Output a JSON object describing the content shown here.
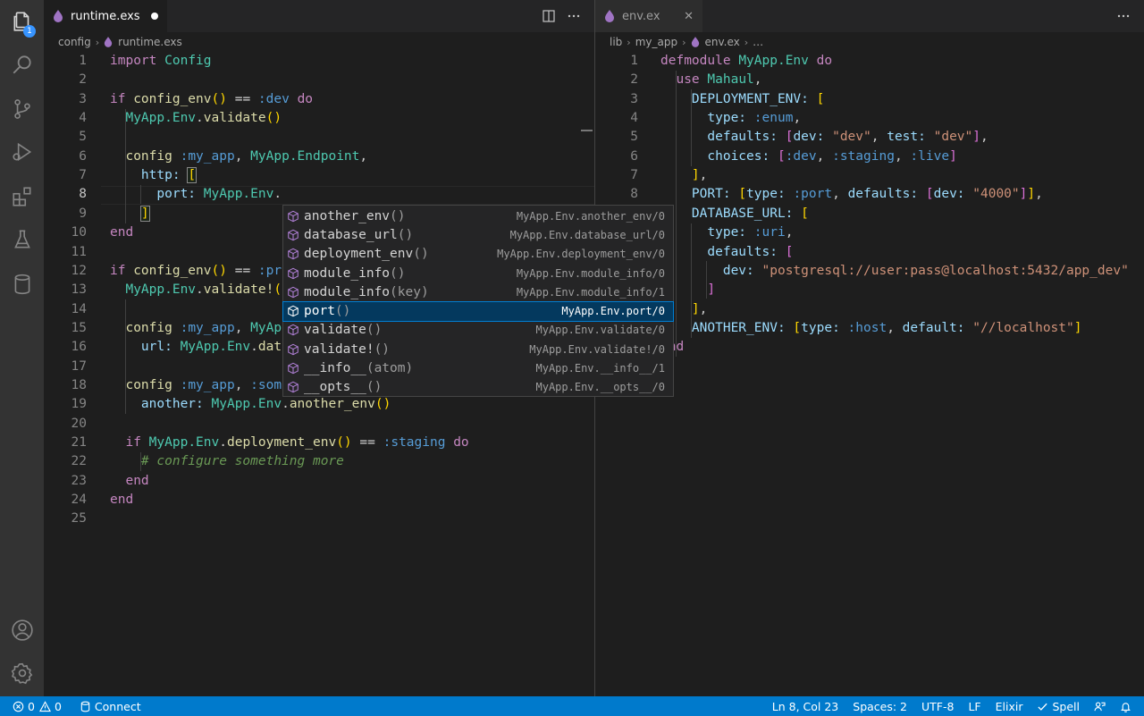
{
  "activity_bar": {
    "explorer_badge": "1",
    "icons": [
      "files-icon",
      "search-icon",
      "source-control-icon",
      "run-debug-icon",
      "extensions-icon",
      "testing-icon",
      "database-icon",
      "account-icon",
      "settings-gear-icon"
    ]
  },
  "left_editor": {
    "tab_label": "runtime.exs",
    "breadcrumb": [
      "config",
      "runtime.exs"
    ],
    "current_line": 8
  },
  "right_editor": {
    "tab_label": "env.ex",
    "breadcrumb": [
      "lib",
      "my_app",
      "env.ex",
      "…"
    ]
  },
  "suggest": {
    "items": [
      {
        "name": "another_env",
        "args": "",
        "detail": "MyApp.Env.another_env/0"
      },
      {
        "name": "database_url",
        "args": "",
        "detail": "MyApp.Env.database_url/0"
      },
      {
        "name": "deployment_env",
        "args": "",
        "detail": "MyApp.Env.deployment_env/0"
      },
      {
        "name": "module_info",
        "args": "",
        "detail": "MyApp.Env.module_info/0"
      },
      {
        "name": "module_info",
        "args": "key",
        "detail": "MyApp.Env.module_info/1"
      },
      {
        "name": "port",
        "args": "",
        "detail": "MyApp.Env.port/0",
        "selected": true
      },
      {
        "name": "validate",
        "args": "",
        "detail": "MyApp.Env.validate/0"
      },
      {
        "name": "validate!",
        "args": "",
        "detail": "MyApp.Env.validate!/0"
      },
      {
        "name": "__info__",
        "args": "atom",
        "detail": "MyApp.Env.__info__/1"
      },
      {
        "name": "__opts__",
        "args": "",
        "detail": "MyApp.Env.__opts__/0"
      }
    ]
  },
  "statusbar": {
    "errors": "0",
    "warnings": "0",
    "connect": "Connect",
    "position": "Ln 8, Col 23",
    "spaces": "Spaces: 2",
    "encoding": "UTF-8",
    "eol": "LF",
    "language": "Elixir",
    "spell": "Spell"
  },
  "colors": {
    "statusbar": "#007acc",
    "activity_bar": "#333333",
    "editor_bg": "#1e1e1e",
    "suggest_selected": "#04395e",
    "elixir_drop": "#a074c4"
  }
}
